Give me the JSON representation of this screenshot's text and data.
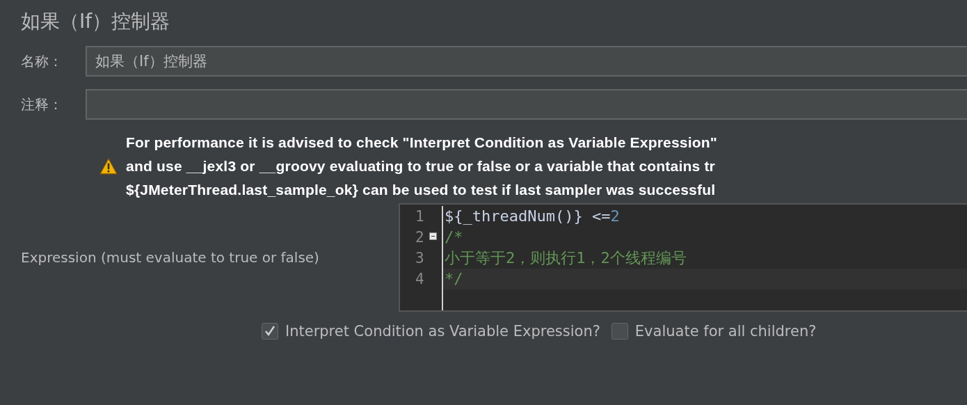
{
  "title": "如果（If）控制器",
  "fields": [
    {
      "label": "名称：",
      "value": "如果（If）控制器"
    },
    {
      "label": "注释："
    }
  ],
  "warning": {
    "lines": [
      "For performance it is advised to check \"Interpret Condition as Variable Expression\"",
      "and use __jexl3 or __groovy evaluating to true or false or a variable that contains tr",
      "${JMeterThread.last_sample_ok} can be used to test if last sampler was successful"
    ]
  },
  "expression": {
    "label": "Expression (must evaluate to true or false)",
    "lines": [
      {
        "number": "1",
        "collapsible": false,
        "tokens": [
          {
            "kind": "plain",
            "text": "${_threadNum()} <="
          },
          {
            "kind": "number",
            "text": "2"
          }
        ]
      },
      {
        "number": "2",
        "collapsible": true,
        "tokens": [
          {
            "kind": "comment",
            "text": "/*"
          }
        ]
      },
      {
        "number": "3",
        "collapsible": false,
        "tokens": [
          {
            "kind": "comment",
            "text": "小于等于2，则执行1，2个线程编号"
          }
        ]
      },
      {
        "number": "4",
        "collapsible": false,
        "tokens": [
          {
            "kind": "comment",
            "text": "*/"
          }
        ]
      }
    ]
  },
  "options": [
    {
      "label": "Interpret Condition as Variable Expression?",
      "checked": true
    },
    {
      "label": "Evaluate for all children?",
      "checked": false
    }
  ]
}
